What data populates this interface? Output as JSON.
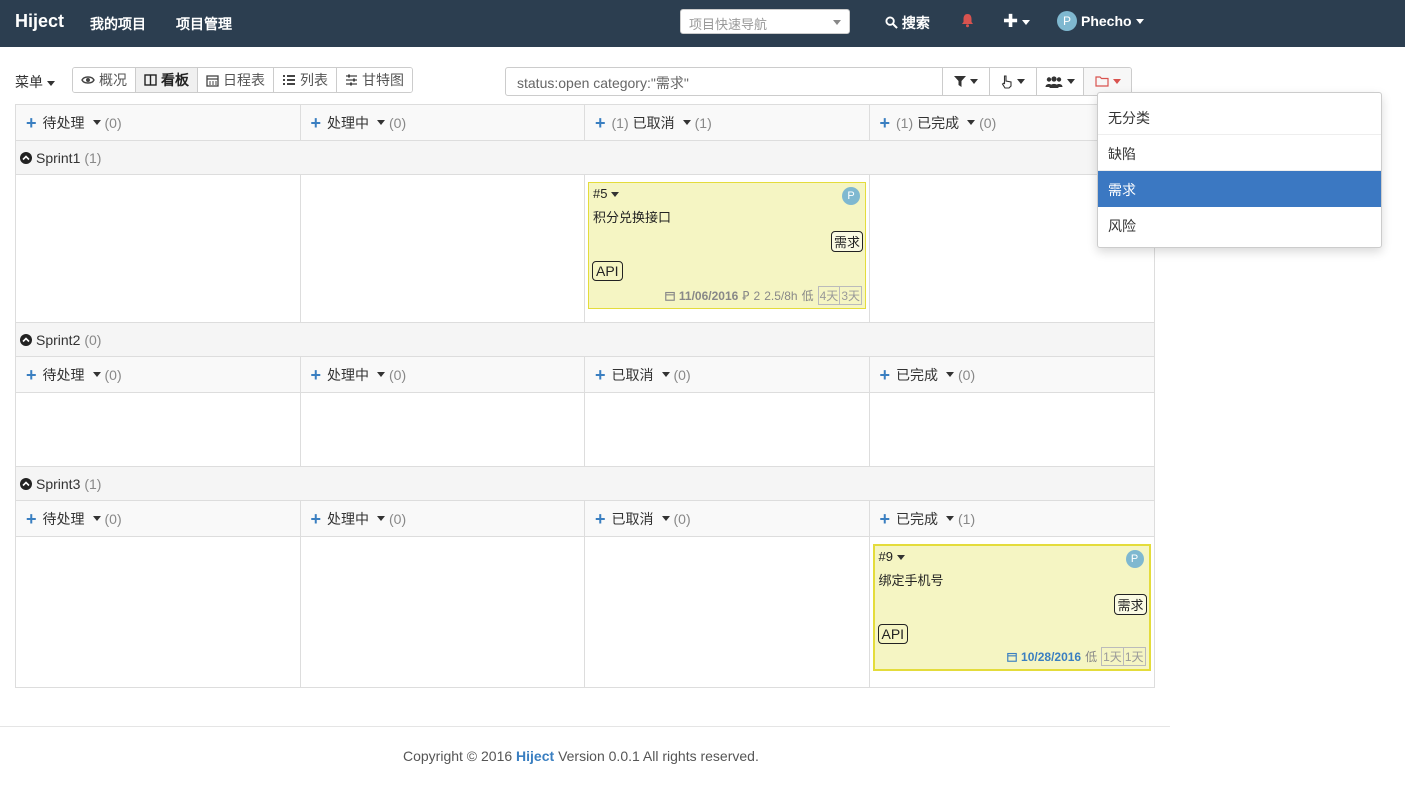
{
  "navbar": {
    "brand": "Hiject",
    "links": [
      "我的项目",
      "项目管理"
    ],
    "quick_nav_placeholder": "项目快速导航",
    "search_label": "搜索",
    "user_initial": "P",
    "user_name": "Phecho",
    "bell_color": "#d9534f"
  },
  "toolbar": {
    "menu_label": "菜单",
    "views": [
      {
        "label": "概况",
        "icon": "eye-icon"
      },
      {
        "label": "看板",
        "icon": "columns-icon",
        "active": true
      },
      {
        "label": "日程表",
        "icon": "calendar-icon"
      },
      {
        "label": "列表",
        "icon": "list-icon"
      },
      {
        "label": "甘特图",
        "icon": "sliders-icon"
      }
    ],
    "search_value": "status:open category:\"需求\"",
    "filter_icons": [
      "filter-icon",
      "hand-pointer-icon",
      "users-icon",
      "folder-icon"
    ]
  },
  "board": {
    "top_columns": [
      {
        "prefix": "",
        "label": "待处理",
        "count": "(0)"
      },
      {
        "prefix": "",
        "label": "处理中",
        "count": "(0)"
      },
      {
        "prefix": "(1)",
        "label": "已取消",
        "count": "(1)"
      },
      {
        "prefix": "(1)",
        "label": "已完成",
        "count": "(0)"
      }
    ],
    "sprints": [
      {
        "name": "Sprint1",
        "count": "(1)"
      },
      {
        "name": "Sprint2",
        "count": "(0)"
      },
      {
        "name": "Sprint3",
        "count": "(1)"
      }
    ],
    "sprint2_columns": [
      {
        "label": "待处理",
        "count": "(0)"
      },
      {
        "label": "处理中",
        "count": "(0)"
      },
      {
        "label": "已取消",
        "count": "(0)"
      },
      {
        "label": "已完成",
        "count": "(0)"
      }
    ],
    "sprint3_columns": [
      {
        "label": "待处理",
        "count": "(0)"
      },
      {
        "label": "处理中",
        "count": "(0)"
      },
      {
        "label": "已取消",
        "count": "(0)"
      },
      {
        "label": "已完成",
        "count": "(1)"
      }
    ],
    "cards": [
      {
        "id": "#5",
        "title": "积分兑换接口",
        "assignee": "P",
        "category": "需求",
        "tag": "API",
        "due_date": "11/06/2016",
        "subtasks": "2",
        "time": "2.5/8h",
        "priority": "低",
        "estimate": "4天",
        "spent": "3天"
      },
      {
        "id": "#9",
        "title": "绑定手机号",
        "assignee": "P",
        "category": "需求",
        "tag": "API",
        "due_date": "10/28/2016",
        "priority": "低",
        "estimate": "1天",
        "spent": "1天"
      }
    ]
  },
  "category_dropdown": {
    "items": [
      "无分类",
      "缺陷",
      "需求",
      "风险"
    ],
    "selected": "需求",
    "highlight_color": "#3b78c2"
  },
  "footer": {
    "prefix": "Copyright © 2016",
    "brand": "Hiject",
    "suffix": "Version 0.0.1 All rights reserved."
  }
}
